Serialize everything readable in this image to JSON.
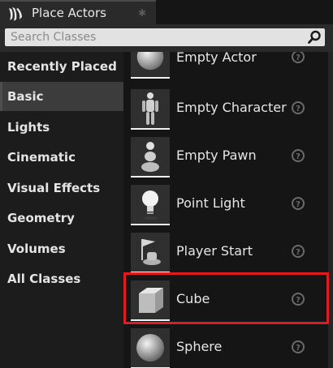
{
  "window": {
    "tab_title": "Place Actors",
    "logo": "unreal-engine-logo-icon"
  },
  "search": {
    "placeholder": "Search Classes",
    "value": "",
    "icon": "search-icon"
  },
  "sidebar": {
    "selected": "Basic",
    "categories": [
      {
        "label": "Recently Placed"
      },
      {
        "label": "Basic"
      },
      {
        "label": "Lights"
      },
      {
        "label": "Cinematic"
      },
      {
        "label": "Visual Effects"
      },
      {
        "label": "Geometry"
      },
      {
        "label": "Volumes"
      },
      {
        "label": "All Classes"
      }
    ]
  },
  "actors": [
    {
      "label": "Empty Actor",
      "icon": "empty-actor-sphere-icon"
    },
    {
      "label": "Empty Character",
      "icon": "character-mannequin-icon"
    },
    {
      "label": "Empty Pawn",
      "icon": "pawn-icon"
    },
    {
      "label": "Point Light",
      "icon": "light-bulb-icon"
    },
    {
      "label": "Player Start",
      "icon": "player-start-flag-icon"
    },
    {
      "label": "Cube",
      "icon": "cube-icon"
    },
    {
      "label": "Sphere",
      "icon": "sphere-icon"
    }
  ],
  "highlighted_item": "Cube",
  "colors": {
    "highlight": "#e01b22",
    "panel_bg": "#1c1c1c",
    "selected_bg": "#3c3c3c"
  }
}
